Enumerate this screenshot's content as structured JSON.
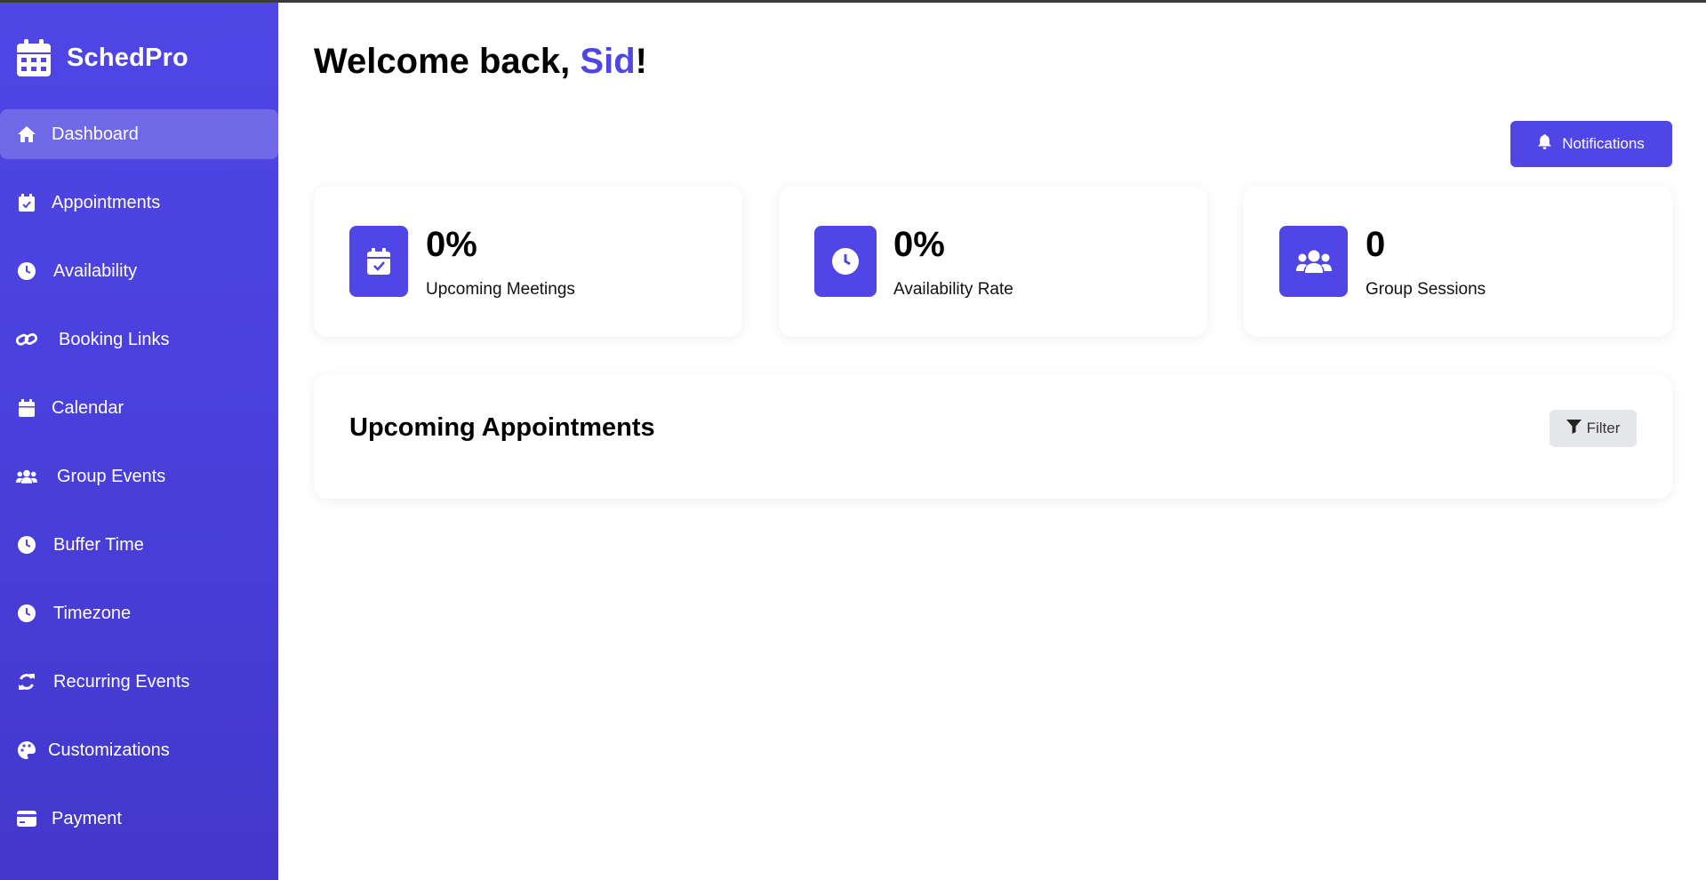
{
  "app": {
    "name": "SchedPro",
    "accent_color": "#4f46e5"
  },
  "sidebar": {
    "items": [
      {
        "label": "Dashboard",
        "icon": "home-icon",
        "active": true
      },
      {
        "label": "Appointments",
        "icon": "calendar-check-icon",
        "active": false
      },
      {
        "label": "Availability",
        "icon": "clock-icon",
        "active": false
      },
      {
        "label": "Booking Links",
        "icon": "link-icon",
        "active": false
      },
      {
        "label": "Calendar",
        "icon": "calendar-icon",
        "active": false
      },
      {
        "label": "Group Events",
        "icon": "users-icon",
        "active": false
      },
      {
        "label": "Buffer Time",
        "icon": "clock-icon",
        "active": false
      },
      {
        "label": "Timezone",
        "icon": "clock-icon",
        "active": false
      },
      {
        "label": "Recurring Events",
        "icon": "sync-icon",
        "active": false
      },
      {
        "label": "Customizations",
        "icon": "palette-icon",
        "active": false
      },
      {
        "label": "Payment",
        "icon": "credit-card-icon",
        "active": false
      }
    ]
  },
  "header": {
    "welcome_prefix": "Welcome back, ",
    "user_name": "Sid",
    "welcome_suffix": "!",
    "notifications_label": "Notifications"
  },
  "stats": [
    {
      "value": "0%",
      "label": "Upcoming Meetings",
      "icon": "calendar-check-icon"
    },
    {
      "value": "0%",
      "label": "Availability Rate",
      "icon": "clock-icon"
    },
    {
      "value": "0",
      "label": "Group Sessions",
      "icon": "users-icon"
    }
  ],
  "appointments": {
    "title": "Upcoming Appointments",
    "filter_label": "Filter"
  }
}
